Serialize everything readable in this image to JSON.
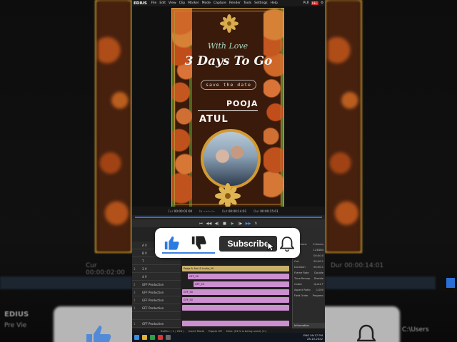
{
  "app": {
    "brand": "EDIUS",
    "menu": [
      "File",
      "Edit",
      "View",
      "Clip",
      "Marker",
      "Mode",
      "Capture",
      "Render",
      "Tools",
      "Settings",
      "Help"
    ],
    "mode_badge": "PLR",
    "rec_badge": "REC"
  },
  "card": {
    "with_love": "With Love",
    "days_to_go": "3 Days To Go",
    "save_the_date": "save the date",
    "name_bride": "POOJA",
    "name_groom": "ATUL"
  },
  "timecode": {
    "cur_label": "Cur",
    "cur_value": "00:00:02:00",
    "in_label": "In",
    "in_value": "--:--:--:--",
    "out_label": "Out",
    "out_value": "00:00:14:01",
    "dur_label": "Dur",
    "dur_value": "00:00:15:01"
  },
  "tracks": [
    {
      "num": "",
      "label": "A V"
    },
    {
      "num": "",
      "label": "B V"
    },
    {
      "num": "",
      "label": "T"
    },
    {
      "num": "3",
      "label": "3 V"
    },
    {
      "num": "",
      "label": "4 V"
    },
    {
      "num": "2",
      "label": "GFF Production"
    },
    {
      "num": "3",
      "label": "GFF Production"
    },
    {
      "num": "2",
      "label": "GFF Production"
    },
    {
      "num": "1",
      "label": "GFF Production"
    },
    {
      "num": "",
      "label": ""
    },
    {
      "num": "1",
      "label": "GFF Production"
    }
  ],
  "clips": [
    {
      "label": "Pooja & Atul & Invite_50",
      "color": "#c9b06a"
    },
    {
      "label": "GFF_50",
      "color": "#cc8fcf"
    },
    {
      "label": "GFF_50",
      "color": "#cc8fcf"
    },
    {
      "label": "GFF_50",
      "color": "#cc8fcf"
    },
    {
      "label": "GFF_50",
      "color": "#cc8fcf"
    },
    {
      "label": "",
      "color": "#cc8fcf"
    },
    {
      "label": "",
      "color": "#cc8fcf"
    }
  ],
  "info": {
    "title": "Information",
    "rows": [
      {
        "k": "File Name",
        "v": "C:\\Users"
      },
      {
        "k": "Clip",
        "v": "123DB4"
      },
      {
        "k": "In",
        "v": "00:00:0"
      },
      {
        "k": "Out",
        "v": "00:00:1"
      },
      {
        "k": "Duration",
        "v": "00:00:1"
      },
      {
        "k": "Frame Rate",
        "v": "Double"
      },
      {
        "k": "Time Remap",
        "v": "Disable"
      },
      {
        "k": "Codec",
        "v": "Quick T"
      },
      {
        "k": "Aspect Ratio",
        "v": "1.000"
      },
      {
        "k": "Field Order",
        "v": "Progress"
      }
    ]
  },
  "status": {
    "buffer": "Buffer: ( 1 / 256 )",
    "insert_mode": "Insert Mode",
    "ripple": "Ripple Off",
    "disk": "Disk: (61% is being used) (C:)"
  },
  "taskbar": {
    "time": "09:17 PM",
    "date": "28-10-2022",
    "lang": "ENG"
  },
  "overlay": {
    "subscribe_label": "Subscribe"
  },
  "blur": {
    "left_tc": "Cur 00:00:02:00",
    "right_tc": "Dur 00:00:14:01",
    "edius": "EDIUS",
    "pre": "Pre Vie",
    "rc": "C:\\Users"
  },
  "colors": {
    "accent_blue": "#2b6fd6",
    "card_bg": "#3a1a0a",
    "gold": "#d4a94a",
    "clip_pink": "#cc8fcf"
  }
}
